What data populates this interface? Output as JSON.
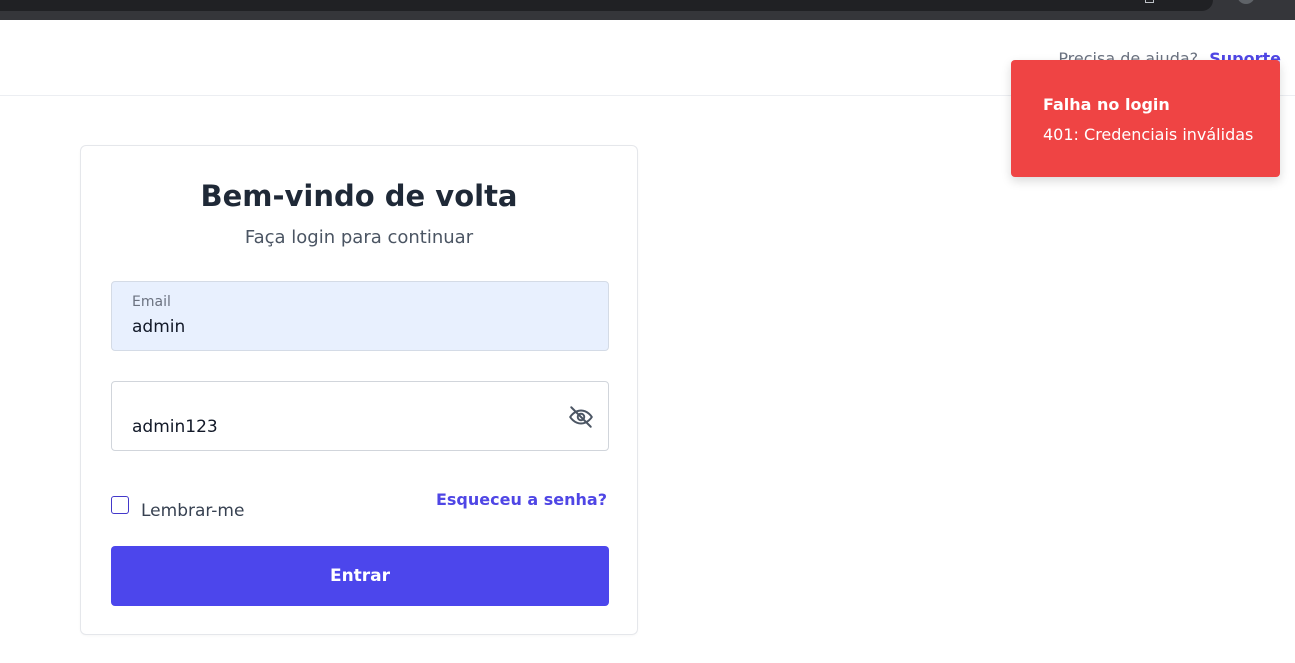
{
  "header": {
    "help_prefix": "Precisa de ajuda?",
    "support_link": "Suporte"
  },
  "login": {
    "title": "Bem-vindo de volta",
    "subtitle": "Faça login para continuar",
    "email_label": "Email",
    "email_value": "admin",
    "password_value": "admin123",
    "remember_label": "Lembrar-me",
    "remember_checked": false,
    "forgot_link": "Esqueceu a senha?",
    "submit_label": "Entrar"
  },
  "toast": {
    "title": "Falha no login",
    "message": "401: Credenciais inválidas",
    "color": "#ef4444"
  },
  "colors": {
    "accent": "#4c46ec",
    "link": "#4f46e5",
    "autofill": "#e8f0fe"
  },
  "icons": {
    "password_toggle": "eye-off-icon"
  }
}
